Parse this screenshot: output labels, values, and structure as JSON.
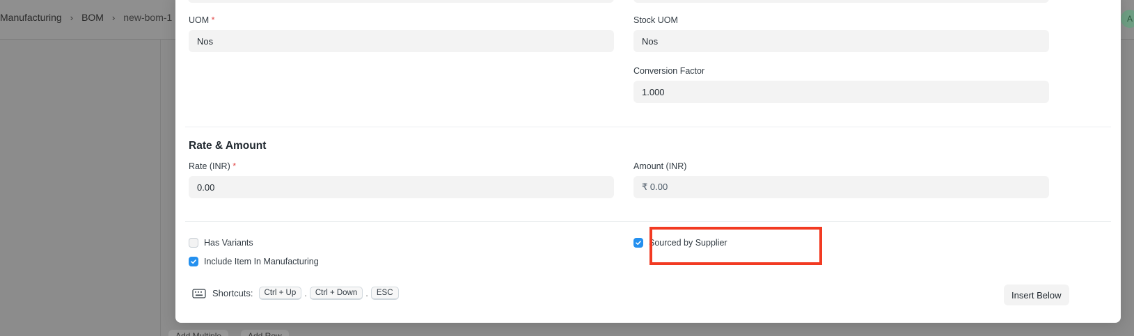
{
  "breadcrumb": {
    "items": [
      "Manufacturing",
      "BOM",
      "new-bom-1"
    ],
    "separator": "›"
  },
  "avatar": {
    "letter": "A"
  },
  "background_buttons": [
    "Add Multiple",
    "Add Row"
  ],
  "form": {
    "uom": {
      "label": "UOM",
      "required_mark": "*",
      "value": "Nos"
    },
    "stock_uom": {
      "label": "Stock UOM",
      "value": "Nos"
    },
    "conversion_factor": {
      "label": "Conversion Factor",
      "value": "1.000"
    },
    "rate_section": {
      "title": "Rate & Amount"
    },
    "rate": {
      "label": "Rate (INR)",
      "required_mark": "*",
      "value": "0.00"
    },
    "amount": {
      "label": "Amount (INR)",
      "value": "₹ 0.00"
    },
    "checkboxes": {
      "has_variants": {
        "label": "Has Variants",
        "checked": false
      },
      "include_item_in_manufacturing": {
        "label": "Include Item In Manufacturing",
        "checked": true
      },
      "sourced_by_supplier": {
        "label": "Sourced by Supplier",
        "checked": true
      }
    }
  },
  "footer": {
    "shortcuts_label": "Shortcuts:",
    "keys": [
      "Ctrl + Up",
      "Ctrl + Down",
      "ESC"
    ],
    "key_separator": ".",
    "insert_below_label": "Insert Below"
  },
  "colors": {
    "accent": "#2490ef",
    "required": "#e24c4c",
    "highlight": "#f23a22"
  }
}
